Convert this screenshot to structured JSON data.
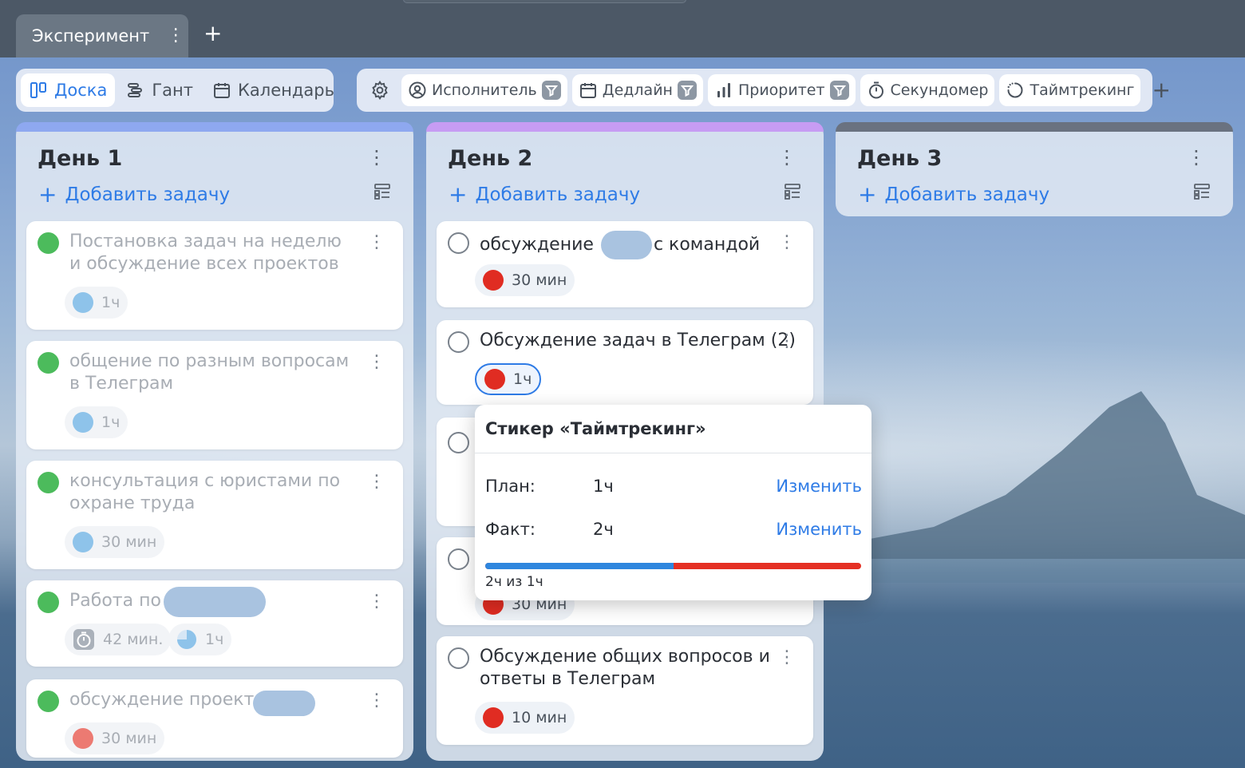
{
  "project_tab": {
    "label": "Эксперимент"
  },
  "views": [
    {
      "label": "Доска",
      "icon": "board-icon",
      "active": true
    },
    {
      "label": "Гант",
      "icon": "gantt-icon",
      "active": false
    },
    {
      "label": "Календарь",
      "icon": "calendar-icon",
      "active": false
    }
  ],
  "toolbar": {
    "assignee": "Исполнитель",
    "deadline": "Дедлайн",
    "priority": "Приоритет",
    "stopwatch": "Секундомер",
    "timetracking": "Таймтрекинг"
  },
  "columns": [
    {
      "title": "День 1",
      "add_label": "Добавить задачу",
      "band_color": "#8ea8f0",
      "cards": [
        {
          "title": "Постановка задач на неделю и обсуждение всех проектов",
          "done": true,
          "pill": "1ч",
          "dot_color": "#8ec3ea"
        },
        {
          "title": "общение по разным вопросам в Телеграм",
          "done": true,
          "pill": "1ч",
          "dot_color": "#8ec3ea"
        },
        {
          "title": "консультация с юристами по охране труда",
          "done": true,
          "pill": "30 мин",
          "dot_color": "#8ec3ea"
        },
        {
          "title": "Работа по",
          "done": true,
          "stopwatch": "42 мин.",
          "pill": "1ч",
          "dot_color": "#8ec3ea"
        },
        {
          "title": "обсуждение проекта",
          "done": true,
          "pill": "30 мин",
          "dot_color": "#ec7a72"
        }
      ]
    },
    {
      "title": "День 2",
      "add_label": "Добавить задачу",
      "band_color": "#c79cf3",
      "cards": [
        {
          "title_a": "обсуждение",
          "title_b": "с командой",
          "done": false,
          "pill": "30 мин",
          "dot_color": "#e02c22"
        },
        {
          "title": "Обсуждение задач в Телеграм (2)",
          "done": false,
          "pill": "1ч",
          "dot_color": "#e02c22"
        },
        {
          "title": "",
          "done": false
        },
        {
          "title": "",
          "done": false,
          "pill": "30 мин"
        },
        {
          "title": "Обсуждение общих вопросов и ответы в Телеграм",
          "done": false,
          "pill": "10 мин",
          "dot_color": "#e02c22"
        }
      ]
    },
    {
      "title": "День 3",
      "add_label": "Добавить задачу",
      "band_color": "#6a7280",
      "cards": []
    }
  ],
  "popup": {
    "title": "Стикер «Таймтрекинг»",
    "plan_label": "План:",
    "plan_value": "1ч",
    "fact_label": "Факт:",
    "fact_value": "2ч",
    "change_label": "Изменить",
    "progress_caption": "2ч из 1ч",
    "plan_fraction": 0.5
  }
}
